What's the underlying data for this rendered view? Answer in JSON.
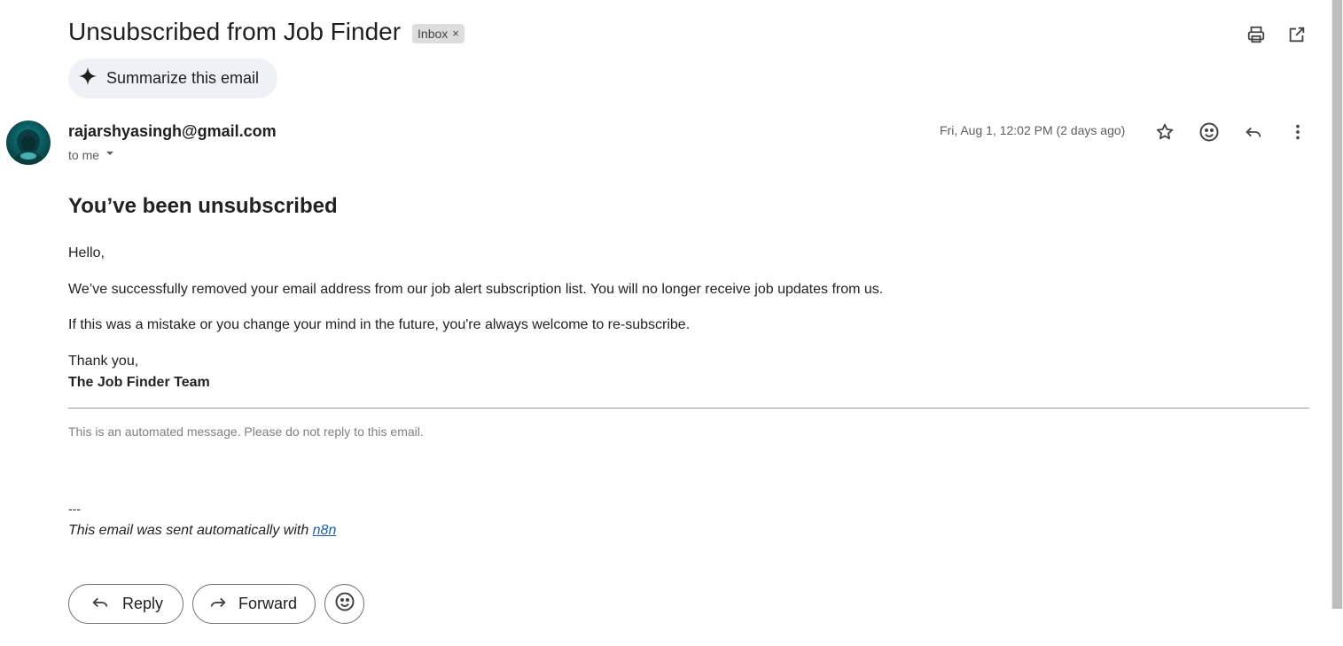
{
  "email": {
    "subject": "Unsubscribed from Job Finder",
    "label": "Inbox",
    "label_remove": "×",
    "summarize_label": "Summarize this email",
    "sender": "rajarshyasingh@gmail.com",
    "recipient": "to me",
    "date": "Fri, Aug 1, 12:02 PM (2 days ago)"
  },
  "body": {
    "heading": "You’ve been unsubscribed",
    "greeting": "Hello,",
    "paragraph1": "We’ve successfully removed your email address from our job alert subscription list. You will no longer receive job updates from us.",
    "paragraph2": "If this was a mistake or you change your mind in the future, you're always welcome to re-subscribe.",
    "closing": "Thank you,",
    "signature": "The Job Finder Team",
    "automated_note": "This is an automated message. Please do not reply to this email.",
    "separator": "---",
    "footer_text": "This email was sent automatically with ",
    "footer_link": "n8n"
  },
  "actions": {
    "reply": "Reply",
    "forward": "Forward"
  },
  "icons": {
    "print": "print-icon",
    "open_new_window": "open-in-new-window-icon",
    "sparkle": "sparkle-icon",
    "star": "star-icon",
    "emoji": "emoji-icon",
    "reply": "reply-icon",
    "more": "more-vert-icon",
    "forward": "forward-icon",
    "dropdown": "chevron-down-icon"
  }
}
